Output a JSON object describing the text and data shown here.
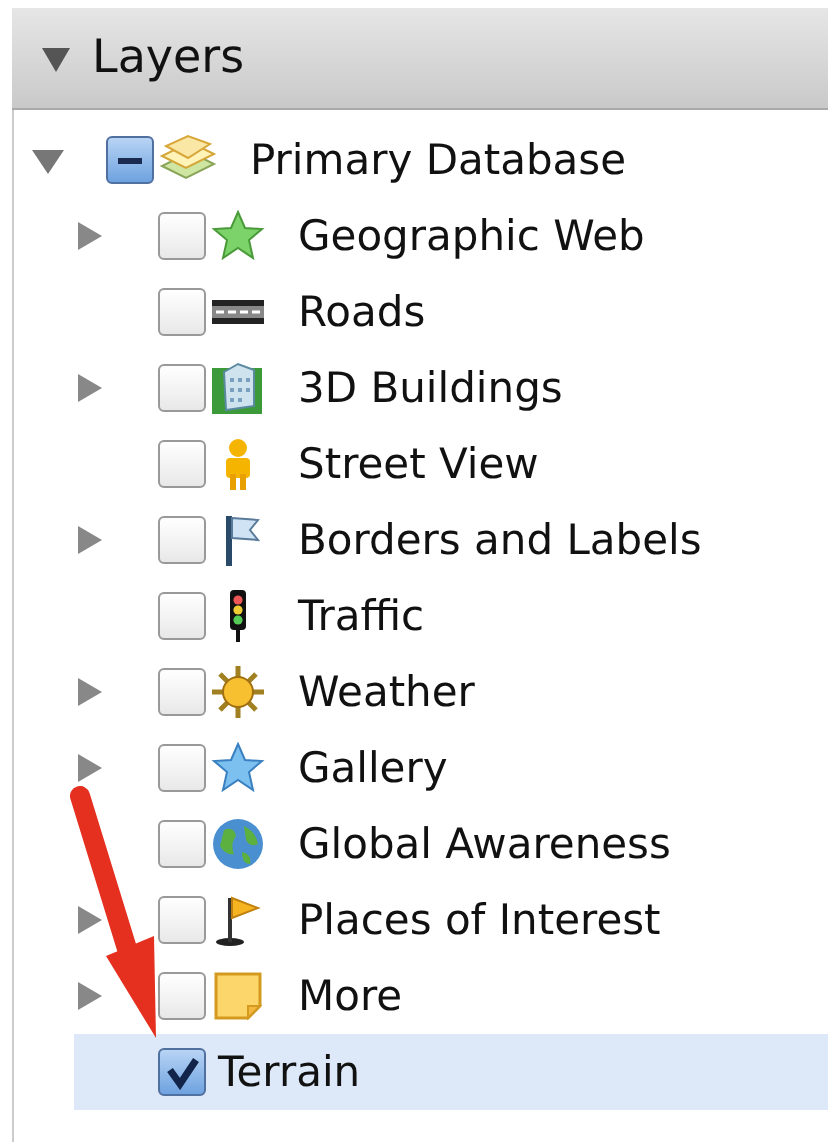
{
  "panel": {
    "title": "Layers",
    "expanded": true
  },
  "tree": {
    "label": "Primary Database",
    "partial": true,
    "expanded": true,
    "children": [
      {
        "label": "Geographic Web",
        "expandable": true,
        "checked": false,
        "selected": false
      },
      {
        "label": "Roads",
        "expandable": false,
        "checked": false,
        "selected": false
      },
      {
        "label": "3D Buildings",
        "expandable": true,
        "checked": false,
        "selected": false
      },
      {
        "label": "Street View",
        "expandable": false,
        "checked": false,
        "selected": false
      },
      {
        "label": "Borders and Labels",
        "expandable": true,
        "checked": false,
        "selected": false
      },
      {
        "label": "Traffic",
        "expandable": false,
        "checked": false,
        "selected": false
      },
      {
        "label": "Weather",
        "expandable": true,
        "checked": false,
        "selected": false
      },
      {
        "label": "Gallery",
        "expandable": true,
        "checked": false,
        "selected": false
      },
      {
        "label": "Global Awareness",
        "expandable": false,
        "checked": false,
        "selected": false
      },
      {
        "label": "Places of Interest",
        "expandable": true,
        "checked": false,
        "selected": false
      },
      {
        "label": "More",
        "expandable": true,
        "checked": false,
        "selected": false
      },
      {
        "label": "Terrain",
        "expandable": false,
        "checked": true,
        "selected": true
      }
    ]
  }
}
